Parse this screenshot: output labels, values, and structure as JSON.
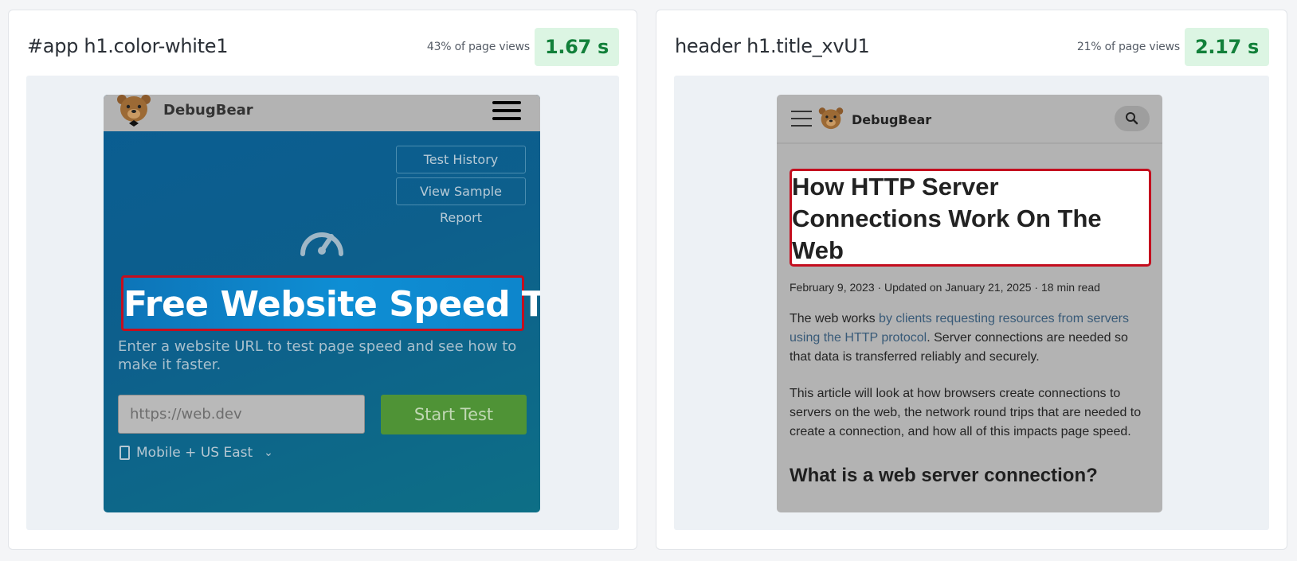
{
  "cards": [
    {
      "selector": "#app h1.color-white1",
      "pct": "43% of page views",
      "time": "1.67 s",
      "preview": {
        "brand": "DebugBear",
        "buttons": [
          "Test History",
          "View Sample Report"
        ],
        "hero_title": "Free Website Speed Test",
        "subtext": "Enter a website URL to test page speed and see how to make it faster.",
        "url_placeholder": "https://web.dev",
        "start_label": "Start Test",
        "device_label": "Mobile + US East"
      }
    },
    {
      "selector": "header h1.title_xvU1",
      "pct": "21% of page views",
      "time": "2.17 s",
      "preview": {
        "brand": "DebugBear",
        "article_title": "How HTTP Server Connections Work On The Web",
        "meta": "February 9, 2023 · Updated on January 21, 2025 · 18 min read",
        "para1_pre": "The web works ",
        "para1_link": "by clients requesting resources from servers using the HTTP protocol",
        "para1_post": ". Server connections are needed so that data is transferred reliably and securely.",
        "para2": "This article will look at how browsers create connections to servers on the web, the network round trips that are needed to create a connection, and how all of this impacts page speed.",
        "h2": "What is a web server connection?"
      }
    }
  ],
  "colors": {
    "badge_bg": "#dcf5e3",
    "badge_text": "#12803a",
    "highlight_border": "#c40e1e",
    "start_button": "#4f9336",
    "link": "#385a78"
  },
  "icons": [
    "bear-logo-icon",
    "hamburger-menu-icon",
    "speed-gauge-icon",
    "search-icon",
    "mobile-device-icon",
    "chevron-down-icon"
  ]
}
